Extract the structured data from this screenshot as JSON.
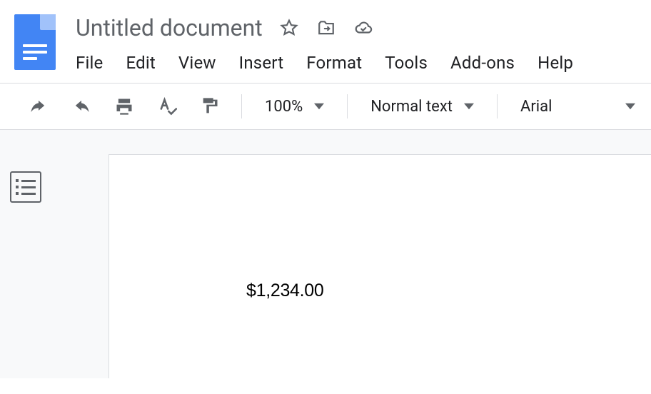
{
  "header": {
    "title": "Untitled document"
  },
  "menu": {
    "items": [
      "File",
      "Edit",
      "View",
      "Insert",
      "Format",
      "Tools",
      "Add-ons",
      "Help"
    ]
  },
  "toolbar": {
    "zoom": "100%",
    "style": "Normal text",
    "font": "Arial"
  },
  "document": {
    "body": "$1,234.00"
  }
}
